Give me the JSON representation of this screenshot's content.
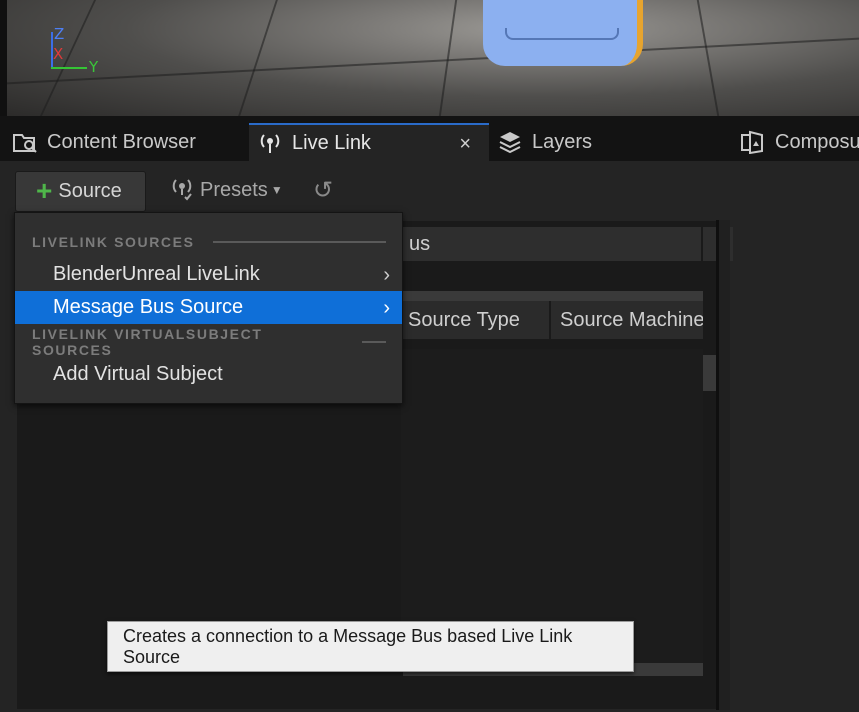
{
  "viewport": {
    "gizmo": {
      "z": "Z",
      "x": "X",
      "y": "Y"
    }
  },
  "tabs": [
    {
      "label": "Content Browser",
      "icon": "content-browser-icon",
      "active": false
    },
    {
      "label": "Live Link",
      "icon": "live-link-icon",
      "active": true,
      "close": "×"
    },
    {
      "label": "Layers",
      "icon": "layers-icon",
      "active": false
    },
    {
      "label": "Composu",
      "icon": "composure-icon",
      "active": false
    }
  ],
  "toolbar": {
    "source_label": "Source",
    "presets_label": "Presets"
  },
  "table": {
    "partial_header": "us",
    "columns": [
      "Source Type",
      "Source Machine"
    ]
  },
  "menu": {
    "section1": "LIVELINK SOURCES",
    "items1": [
      {
        "label": "BlenderUnreal LiveLink",
        "arrow": "›"
      },
      {
        "label": "Message Bus Source",
        "arrow": "›"
      }
    ],
    "section2": "LIVELINK VIRTUALSUBJECT SOURCES",
    "items2": [
      {
        "label": "Add Virtual Subject"
      }
    ]
  },
  "tooltip": {
    "text": "Creates a connection to a Message Bus based Live Link Source"
  },
  "colors": {
    "accent": "#0f6fd8",
    "tab_active_border": "#2a6bc9",
    "add_green": "#4fb64a"
  }
}
